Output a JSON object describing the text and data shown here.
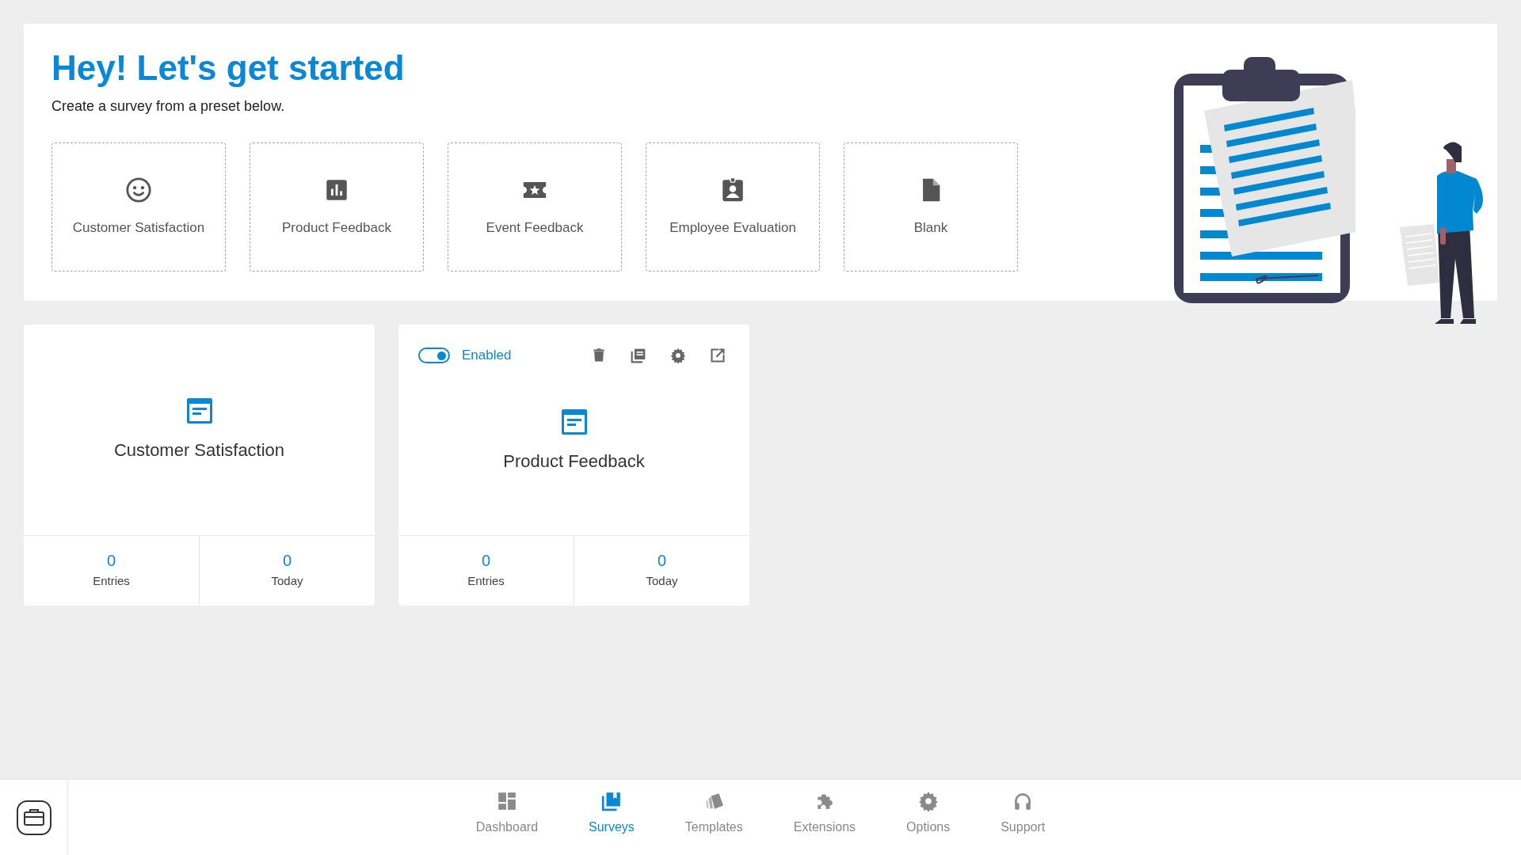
{
  "header": {
    "title": "Hey! Let's get started",
    "subtitle": "Create a survey from a preset below."
  },
  "presets": [
    {
      "label": "Customer Satisfaction",
      "kind": "smile"
    },
    {
      "label": "Product Feedback",
      "kind": "chart"
    },
    {
      "label": "Event Feedback",
      "kind": "ticket"
    },
    {
      "label": "Employee Evaluation",
      "kind": "badge"
    },
    {
      "label": "Blank",
      "kind": "file"
    }
  ],
  "surveys": [
    {
      "title": "Customer Satisfaction",
      "stats": [
        {
          "value": "0",
          "label": "Entries"
        },
        {
          "value": "0",
          "label": "Today"
        }
      ]
    },
    {
      "title": "Product Feedback",
      "toggle": {
        "label": "Enabled",
        "on": true
      },
      "actions": [
        {
          "kind": "delete"
        },
        {
          "kind": "copy"
        },
        {
          "kind": "settings"
        },
        {
          "kind": "open"
        }
      ],
      "stats": [
        {
          "value": "0",
          "label": "Entries"
        },
        {
          "value": "0",
          "label": "Today"
        }
      ]
    }
  ],
  "nav": [
    {
      "label": "Dashboard",
      "kind": "dashboard",
      "selected": false
    },
    {
      "label": "Surveys",
      "kind": "surveys",
      "selected": true
    },
    {
      "label": "Templates",
      "kind": "templates",
      "selected": false
    },
    {
      "label": "Extensions",
      "kind": "extensions",
      "selected": false
    },
    {
      "label": "Options",
      "kind": "options",
      "selected": false
    },
    {
      "label": "Support",
      "kind": "support",
      "selected": false
    }
  ]
}
